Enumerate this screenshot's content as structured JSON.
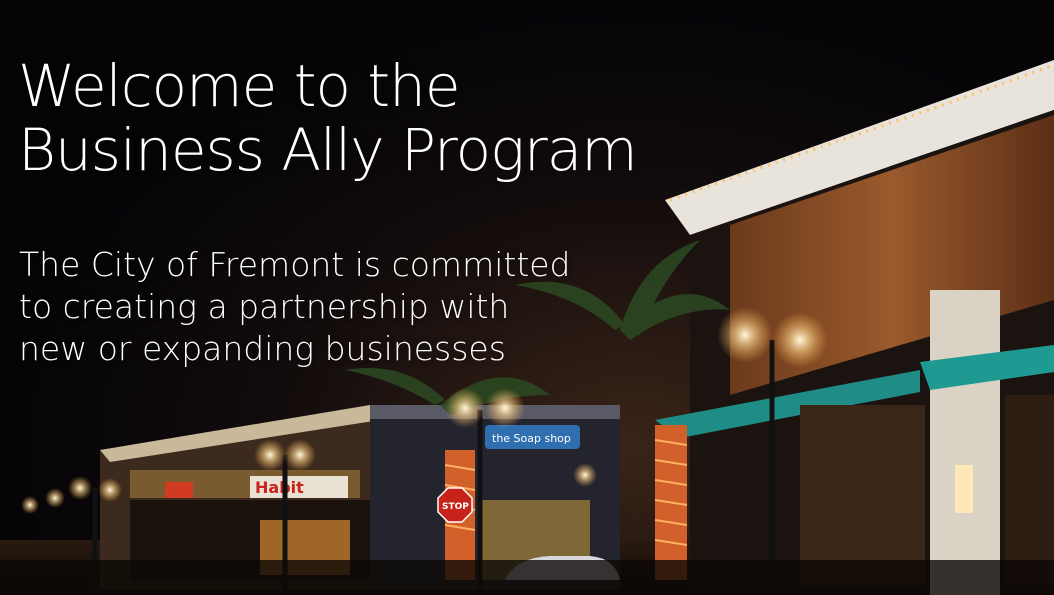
{
  "hero": {
    "headline_line1": "Welcome to the",
    "headline_line2": "Business Ally Program",
    "sub_line1": "The City of Fremont is committed",
    "sub_line2": "to creating a partnership with",
    "sub_line3": "new or expanding businesses"
  },
  "storefront_signs": {
    "habit": "Habit",
    "stop": "STOP",
    "shop": "the Soap shop"
  }
}
